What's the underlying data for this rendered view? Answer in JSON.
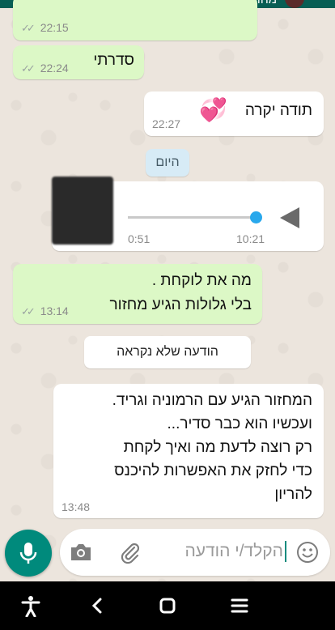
{
  "header": {
    "contact_status": "מחובר/ת"
  },
  "messages": [
    {
      "type": "outgoing",
      "text": "",
      "time": "22:15",
      "ticks": "✓✓"
    },
    {
      "type": "outgoing",
      "text": "סדרתי",
      "time": "22:24",
      "ticks": "✓✓"
    },
    {
      "type": "incoming",
      "text": "תודה יקרה",
      "emoji": "💞",
      "time": "22:27"
    },
    {
      "type": "incoming-voice",
      "duration": "0:51",
      "time": "10:21"
    },
    {
      "type": "outgoing",
      "lines": [
        "מה את לוקחת .",
        "בלי גלולות הגיע מחזור"
      ],
      "time": "13:14",
      "ticks": "✓✓"
    },
    {
      "type": "incoming",
      "lines": [
        "המחזור הגיע עם הרמוניה וגריד.",
        "ועכשיו הוא כבר סדיר...",
        "רק רוצה לדעת מה ואיך לקחת",
        "כדי לחזק את האפשרות להיכנס",
        "להריון"
      ],
      "time": "13:48"
    }
  ],
  "date_chip": "היום",
  "unread_chip": "הודעה שלא נקראה",
  "composer": {
    "placeholder": "הקלד/י הודעה"
  },
  "colors": {
    "outgoing": "#dcf8c6",
    "incoming": "#ffffff",
    "accent": "#008a7c",
    "date_chip": "#d7ebf6",
    "audio_dot": "#29a8ec"
  },
  "icons": [
    "emoji-icon",
    "attach-icon",
    "camera-icon",
    "mic-icon",
    "play-icon",
    "accessibility-icon",
    "back-icon",
    "home-icon",
    "recents-icon"
  ]
}
